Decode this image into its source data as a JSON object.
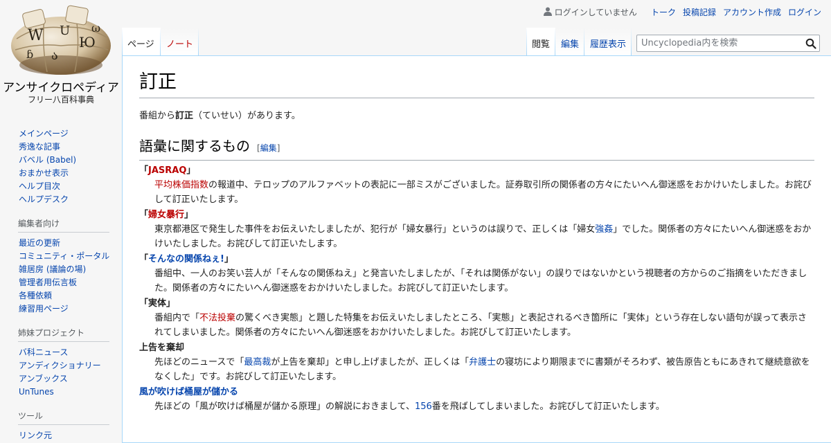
{
  "site": {
    "title": "アンサイクロペディア",
    "subtitle": "フリー八百科事典"
  },
  "personal": {
    "anon": "ログインしていません",
    "links": [
      "トーク",
      "投稿記録",
      "アカウント作成",
      "ログイン"
    ]
  },
  "tabs": {
    "left": [
      "ページ",
      "ノート"
    ],
    "right": [
      "閲覧",
      "編集",
      "履歴表示"
    ]
  },
  "search": {
    "placeholder": "Uncyclopedia内を検索"
  },
  "sidebar": {
    "nav": [
      "メインページ",
      "秀逸な記事",
      "バベル (Babel)",
      "おまかせ表示",
      "ヘルプ目次",
      "ヘルプデスク"
    ],
    "editors_heading": "編集者向け",
    "editors": [
      "最近の更新",
      "コミュニティ・ポータル",
      "雑居房 (議論の場)",
      "管理者用伝言板",
      "各種依頼",
      "練習用ページ"
    ],
    "sister_heading": "姉妹プロジェクト",
    "sister": [
      "バ科ニュース",
      "アンディクショナリー",
      "アンブックス",
      "UnTunes"
    ],
    "tools_heading": "ツール",
    "tools": [
      "リンク元"
    ]
  },
  "article": {
    "title": "訂正",
    "intro_a": "番組から",
    "intro_b": "訂正",
    "intro_c": "（ていせい）があります。",
    "section_title": "語彙に関するもの",
    "edit_open": "[",
    "edit_label": "編集",
    "edit_close": "]",
    "e1": {
      "q1": "「",
      "term": "JASRAQ",
      "q2": "」",
      "link": "平均株価指数",
      "text": "の報道中、テロップのアルファベットの表記に一部ミスがございました。証券取引所の関係者の方々にたいへん御迷惑をおかけいたしました。お詫びして訂正いたします。"
    },
    "e2": {
      "q1": "「",
      "term": "婦女暴行",
      "q2": "」",
      "t1": "東京都港区で発生した事件をお伝えいたしましたが、犯行が「婦女暴行」というのは誤りで、正しくは「婦女",
      "link": "強姦",
      "t2": "」でした。関係者の方々にたいへん御迷惑をおかけいたしました。お詫びして訂正いたします。"
    },
    "e3": {
      "q1": "「",
      "term": "そんなの関係ねぇ!",
      "q2": "」",
      "text": "番組中、一人のお笑い芸人が「そんなの関係ねえ」と発言いたしましたが、「それは関係がない」の誤りではないかという視聴者の方からのご指摘をいただきました。関係者の方々にたいへん御迷惑をおかけいたしました。お詫びして訂正いたします。"
    },
    "e4": {
      "term": "「実体」",
      "t1": "番組内で「",
      "link": "不法投棄",
      "t2": "の驚くべき実態」と題した特集をお伝えいたしましたところ、「実態」と表記されるべき箇所に「実体」という存在しない語句が誤って表示されてしまいました。関係者の方々にたいへん御迷惑をおかけいたしました。お詫びして訂正いたします。"
    },
    "e5": {
      "term": "上告を棄却",
      "t1": "先ほどのニュースで「",
      "link1": "最高裁",
      "t2": "が上告を棄却」と申し上げましたが、正しくは「",
      "link2": "弁護士",
      "t3": "の寝坊により期限までに書類がそろわず、被告原告ともにあきれて継続意欲をなくした」です。お詫びして訂正いたします。"
    },
    "e6": {
      "term": "風が吹けば桶屋が儲かる",
      "t1": "先ほどの「風が吹けば桶屋が儲かる原理」の解説におきまして、",
      "link": "156",
      "t2": "番を飛ばしてしまいました。お詫びして訂正いたします。"
    }
  }
}
